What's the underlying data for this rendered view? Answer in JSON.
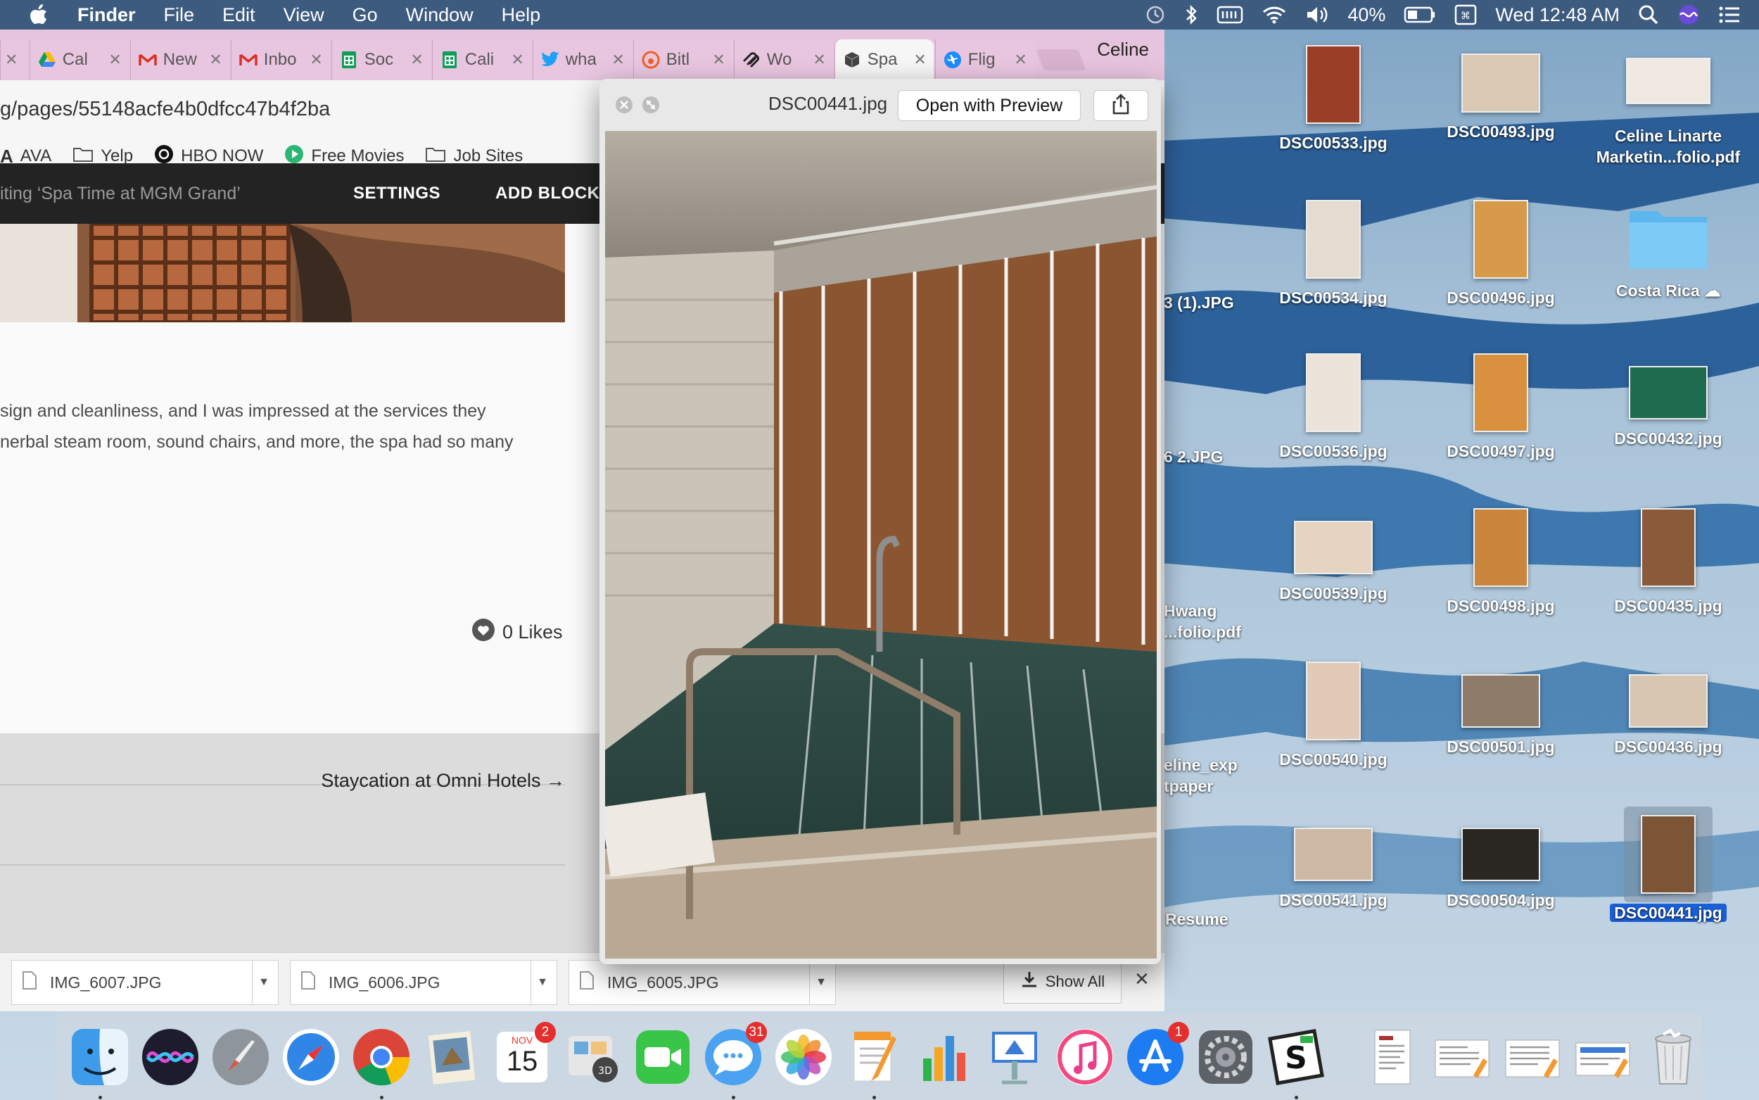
{
  "menubar": {
    "app_name": "Finder",
    "menus": [
      "File",
      "Edit",
      "View",
      "Go",
      "Window",
      "Help"
    ],
    "battery": "40%",
    "clock": "Wed 12:48 AM"
  },
  "browser": {
    "tabs": [
      {
        "label": "Cal",
        "icon": "google-drive-icon"
      },
      {
        "label": "New",
        "icon": "gmail-icon"
      },
      {
        "label": "Inbo",
        "icon": "gmail-icon"
      },
      {
        "label": "Soc",
        "icon": "google-sheets-icon"
      },
      {
        "label": "Cali",
        "icon": "google-sheets-icon"
      },
      {
        "label": "wha",
        "icon": "twitter-icon"
      },
      {
        "label": "Bitl",
        "icon": "bitly-icon"
      },
      {
        "label": "Wo",
        "icon": "squarespace-icon"
      },
      {
        "label": "Spa",
        "icon": "cube-icon"
      },
      {
        "label": "Flig",
        "icon": "plane-icon"
      }
    ],
    "profile": "Celine",
    "url": "g/pages/55148acfe4b0dfcc47b4f2ba",
    "bookmarks": [
      "AVA",
      "Yelp",
      "HBO NOW",
      "Free Movies",
      "Job Sites"
    ],
    "editor": {
      "editing_label": "iting ‘Spa Time at MGM Grand’",
      "settings": "SETTINGS",
      "add_block": "ADD BLOCK"
    },
    "article": {
      "line1": "sign and cleanliness, and I was impressed at the services they",
      "line2": "nerbal steam room, sound chairs, and more, the spa had so many",
      "likes": "0 Likes",
      "next_post": "Staycation at Omni Hotels →"
    },
    "downloads": {
      "items": [
        "IMG_6007.JPG",
        "IMG_6006.JPG",
        "IMG_6005.JPG"
      ],
      "show_all": "Show All"
    }
  },
  "quicklook": {
    "filename": "DSC00441.jpg",
    "open_button": "Open with Preview"
  },
  "desktop": {
    "partial_labels": [
      "3 (1).JPG",
      "6 2.JPG",
      "Hwang",
      "...folio.pdf",
      "eline_exp",
      "tpaper",
      "Resume"
    ],
    "icons": [
      {
        "label": "DSC00533.jpg"
      },
      {
        "label": "DSC00493.jpg"
      },
      {
        "label": "Celine Linarte",
        "label2": "Marketin...folio.pdf"
      },
      {
        "label": "DSC00534.jpg"
      },
      {
        "label": "DSC00496.jpg"
      },
      {
        "label": "Costa Rica"
      },
      {
        "label": "DSC00536.jpg"
      },
      {
        "label": "DSC00497.jpg"
      },
      {
        "label": "DSC00432.jpg"
      },
      {
        "label": "DSC00539.jpg"
      },
      {
        "label": "DSC00498.jpg"
      },
      {
        "label": "DSC00435.jpg"
      },
      {
        "label": "DSC00540.jpg"
      },
      {
        "label": "DSC00501.jpg"
      },
      {
        "label": "DSC00436.jpg"
      },
      {
        "label": "DSC00541.jpg"
      },
      {
        "label": "DSC00504.jpg"
      },
      {
        "label": "DSC00441.jpg"
      }
    ]
  },
  "dock": {
    "calendar_month": "NOV",
    "calendar_day": "15",
    "calendar_badge": "2",
    "messages_badge": "31",
    "appstore_badge": "1"
  },
  "colors": {
    "menubar": "#37557a",
    "tabstrip": "#e7c4de",
    "site_bar": "#232323",
    "selection": "#1a5fd6"
  }
}
